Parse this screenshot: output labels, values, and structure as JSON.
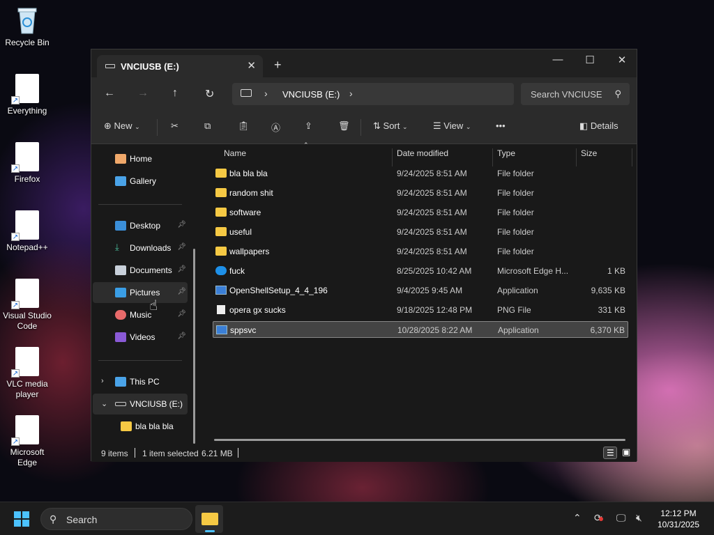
{
  "desktop": {
    "icons": [
      {
        "label": "Recycle Bin"
      },
      {
        "label": "Everything"
      },
      {
        "label": "Firefox"
      },
      {
        "label": "Notepad++"
      },
      {
        "label": "Visual Studio Code"
      },
      {
        "label": "VLC media player"
      },
      {
        "label": "Microsoft Edge"
      }
    ]
  },
  "window": {
    "tab_title": "VNCIUSB (E:)",
    "tab_close": "✕",
    "new_tab": "+",
    "controls": {
      "minimize": "—",
      "maximize": "☐",
      "close": "✕"
    }
  },
  "navbar": {
    "back": "←",
    "forward": "→",
    "up": "↑",
    "refresh": "↻",
    "breadcrumb": "VNCIUSB (E:)",
    "chevron": "›",
    "search_placeholder": "Search VNCIUSE",
    "search_icon": "⚲"
  },
  "toolbar": {
    "new_label": "New",
    "sort_label": "Sort",
    "view_label": "View",
    "more": "•••",
    "details_label": "Details"
  },
  "sidebar": {
    "home": "Home",
    "gallery": "Gallery",
    "pinned": [
      "Desktop",
      "Downloads",
      "Documents",
      "Pictures",
      "Music",
      "Videos"
    ],
    "this_pc": "This PC",
    "drive": "VNCIUSB (E:)",
    "drive_child": "bla bla bla"
  },
  "columns": {
    "name": "Name",
    "date": "Date modified",
    "type": "Type",
    "size": "Size"
  },
  "files": [
    {
      "name": "bla bla bla",
      "date": "9/24/2025 8:51 AM",
      "type": "File folder",
      "size": "",
      "icon": "folder"
    },
    {
      "name": "random shit",
      "date": "9/24/2025 8:51 AM",
      "type": "File folder",
      "size": "",
      "icon": "folder"
    },
    {
      "name": "software",
      "date": "9/24/2025 8:51 AM",
      "type": "File folder",
      "size": "",
      "icon": "folder"
    },
    {
      "name": "useful",
      "date": "9/24/2025 8:51 AM",
      "type": "File folder",
      "size": "",
      "icon": "folder"
    },
    {
      "name": "wallpapers",
      "date": "9/24/2025 8:51 AM",
      "type": "File folder",
      "size": "",
      "icon": "folder"
    },
    {
      "name": "fuck",
      "date": "8/25/2025 10:42 AM",
      "type": "Microsoft Edge H...",
      "size": "1 KB",
      "icon": "edge"
    },
    {
      "name": "OpenShellSetup_4_4_196",
      "date": "9/4/2025 9:45 AM",
      "type": "Application",
      "size": "9,635 KB",
      "icon": "app"
    },
    {
      "name": "opera gx sucks",
      "date": "9/18/2025 12:48 PM",
      "type": "PNG File",
      "size": "331 KB",
      "icon": "png"
    },
    {
      "name": "sppsvc",
      "date": "10/28/2025 8:22 AM",
      "type": "Application",
      "size": "6,370 KB",
      "icon": "app",
      "selected": true
    }
  ],
  "status": {
    "items": "9 items",
    "selected": "1 item selected",
    "size": "6.21 MB"
  },
  "taskbar": {
    "search_placeholder": "Search",
    "time": "12:12 PM",
    "date": "10/31/2025"
  },
  "colors": {
    "accent": "#4cc2ff",
    "folder": "#f6c944",
    "window_bg": "#191919"
  }
}
